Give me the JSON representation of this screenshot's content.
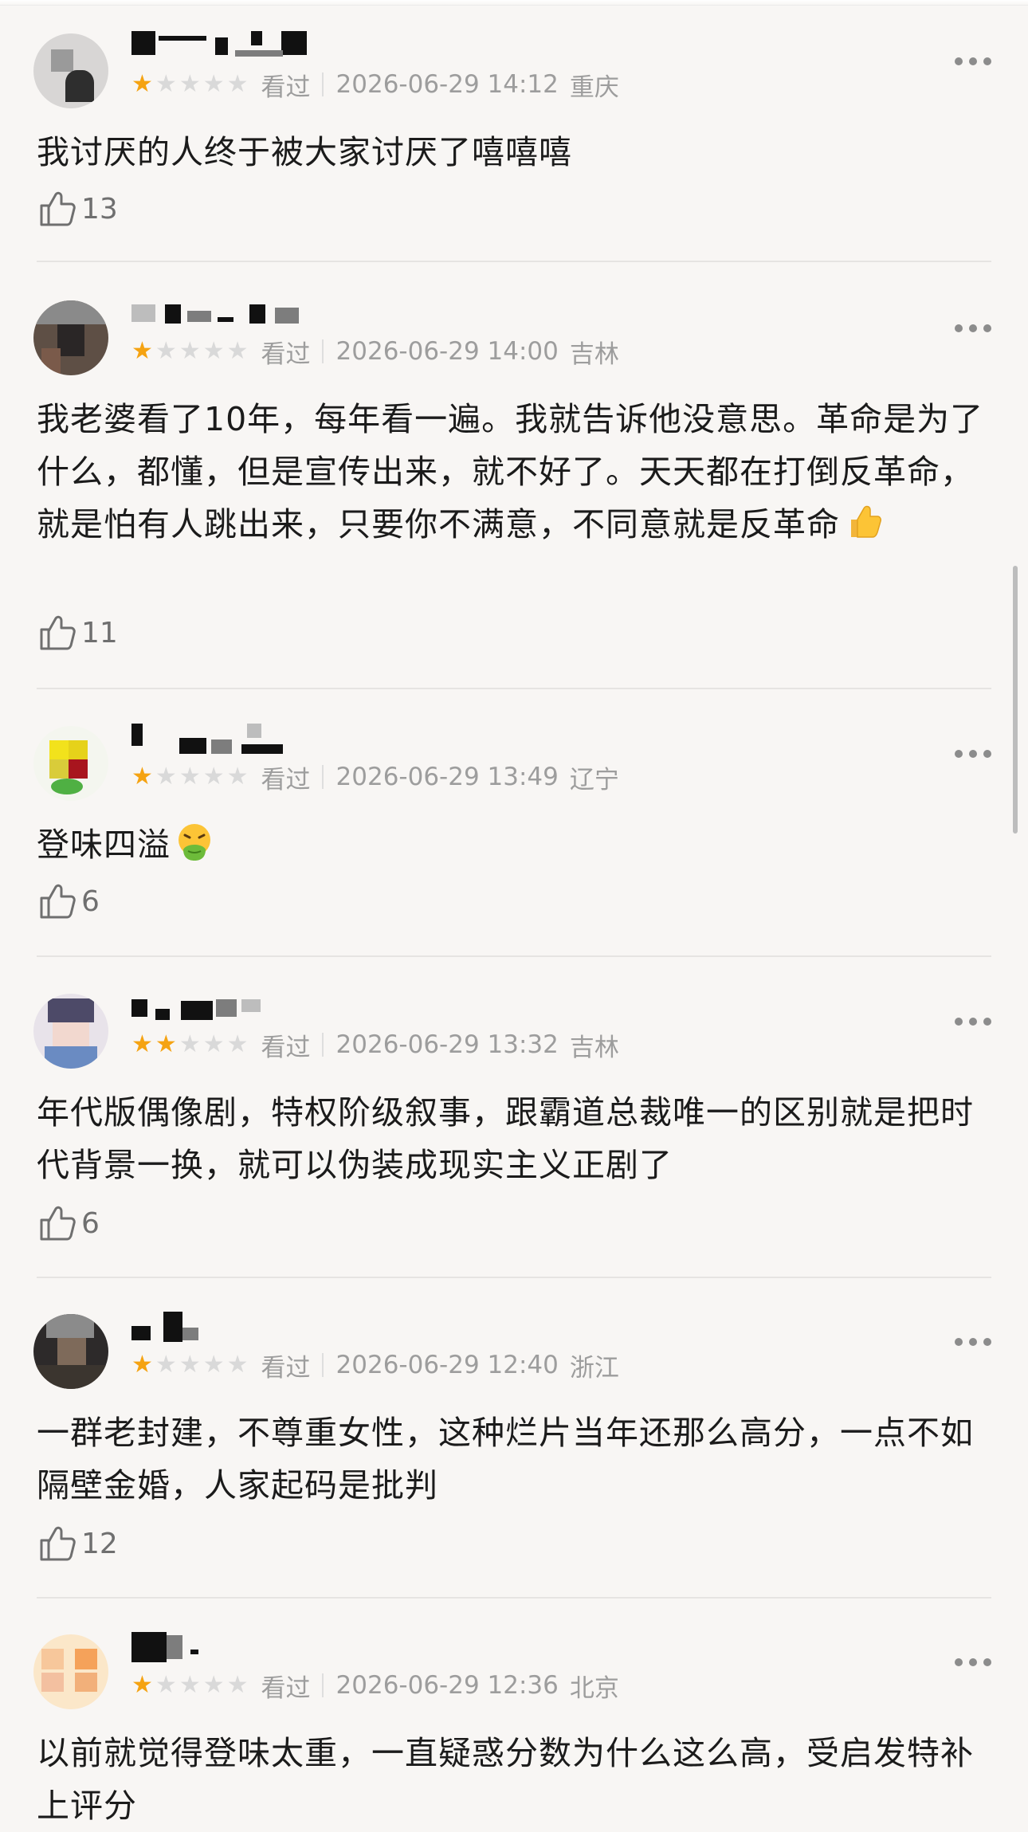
{
  "reviews": [
    {
      "rating": 1,
      "status": "看过",
      "datetime": "2026-06-29 14:12",
      "region": "重庆",
      "content": "我讨厌的人终于被大家讨厌了嘻嘻嘻",
      "emoji": null,
      "likes": "13"
    },
    {
      "rating": 1,
      "status": "看过",
      "datetime": "2026-06-29 14:00",
      "region": "吉林",
      "content": "我老婆看了10年，每年看一遍。我就告诉他没意思。革命是为了什么，都懂，但是宣传出来，就不好了。天天都在打倒反革命，就是怕有人跳出来，只要你不满意，不同意就是反革命",
      "emoji": "thumbs-up-emoji",
      "likes": "11"
    },
    {
      "rating": 1,
      "status": "看过",
      "datetime": "2026-06-29 13:49",
      "region": "辽宁",
      "content": "登味四溢",
      "emoji": "nauseated-face-emoji",
      "likes": "6"
    },
    {
      "rating": 2,
      "status": "看过",
      "datetime": "2026-06-29 13:32",
      "region": "吉林",
      "content": "年代版偶像剧，特权阶级叙事，跟霸道总裁唯一的区别就是把时代背景一换，就可以伪装成现实主义正剧了",
      "emoji": null,
      "likes": "6"
    },
    {
      "rating": 1,
      "status": "看过",
      "datetime": "2026-06-29 12:40",
      "region": "浙江",
      "content": "一群老封建，不尊重女性，这种烂片当年还那么高分，一点不如隔壁金婚，人家起码是批判",
      "emoji": null,
      "likes": "12"
    },
    {
      "rating": 1,
      "status": "看过",
      "datetime": "2026-06-29 12:36",
      "region": "北京",
      "content": "以前就觉得登味太重，一直疑惑分数为什么这么高，受启发特补上评分",
      "emoji": null,
      "likes": ""
    }
  ],
  "colors": {
    "star_on": "#f5a312",
    "star_off": "#d9d9d9",
    "meta_text": "#9d9d9d",
    "background": "#f8f6f4"
  },
  "icons": {
    "more": "more-dots-icon",
    "like": "thumbs-up-icon",
    "star": "star-icon"
  }
}
